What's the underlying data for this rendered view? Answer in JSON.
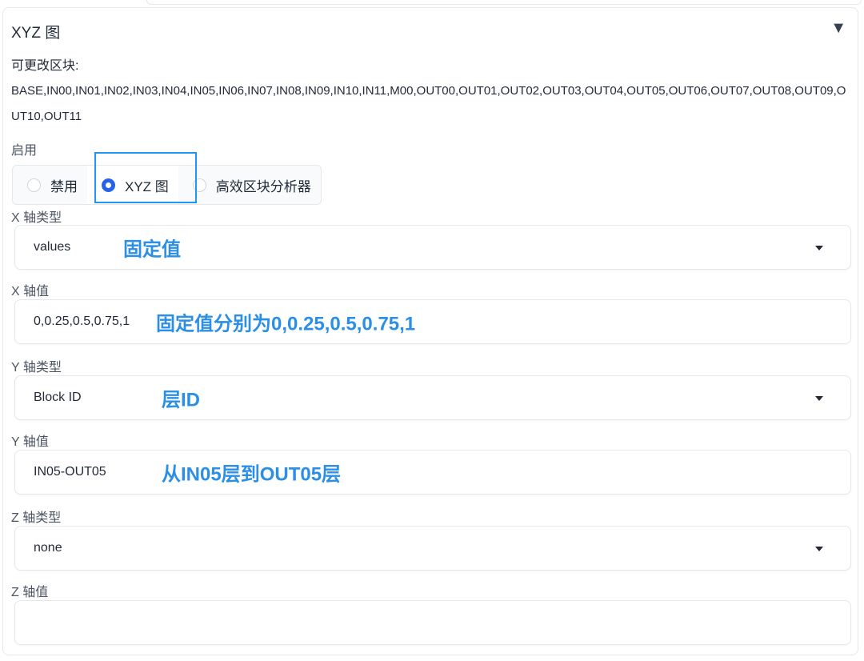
{
  "panel": {
    "title": "XYZ 图",
    "toggle_icon": "▼"
  },
  "changeable_blocks": {
    "label": "可更改区块:",
    "value": "BASE,IN00,IN01,IN02,IN03,IN04,IN05,IN06,IN07,IN08,IN09,IN10,IN11,M00,OUT00,OUT01,OUT02,OUT03,OUT04,OUT05,OUT06,OUT07,OUT08,OUT09,OUT10,OUT11"
  },
  "enable": {
    "label": "启用",
    "options": [
      "禁用",
      "XYZ 图",
      "高效区块分析器"
    ],
    "selected": "XYZ 图"
  },
  "x_axis_type": {
    "label": "X 轴类型",
    "value": "values",
    "annotation": "固定值"
  },
  "x_axis_value": {
    "label": "X 轴值",
    "value": "0,0.25,0.5,0.75,1",
    "annotation": "固定值分别为0,0.25,0.5,0.75,1"
  },
  "y_axis_type": {
    "label": "Y 轴类型",
    "value": "Block ID",
    "annotation": "层ID"
  },
  "y_axis_value": {
    "label": "Y 轴值",
    "value": "IN05-OUT05",
    "annotation": "从IN05层到OUT05层"
  },
  "z_axis_type": {
    "label": "Z 轴类型",
    "value": "none"
  },
  "z_axis_value": {
    "label": "Z 轴值",
    "value": ""
  },
  "colors": {
    "accent": "#2563eb",
    "annotation": "#2b8fe6",
    "highlight_border": "#2196f3"
  }
}
